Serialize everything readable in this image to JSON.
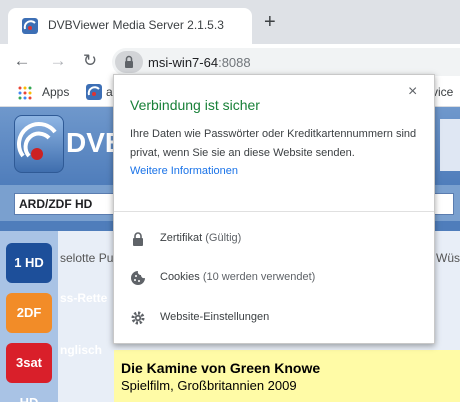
{
  "tab": {
    "title": "DVBViewer Media Server 2.1.5.3",
    "close_icon": "×"
  },
  "toolbar": {
    "new_tab": "+",
    "url_host": "msi-win7-64",
    "url_port": ":8088"
  },
  "bookmarks": {
    "apps_label": "Apps",
    "bookmark_fragment": "a",
    "right_fragment": "vice"
  },
  "page": {
    "logo_text": "DVB",
    "channel_select": "ARD/ZDF HD",
    "channels": [
      "1 HD",
      "2DF HD",
      "3sat HD"
    ],
    "row1_text": "selotte Pu",
    "row1_right": "Wüs",
    "row2_text": "ss-Rette",
    "row3_text": "nglisch",
    "program_title": "Die Kamine von Green Knowe",
    "program_subtitle": "Spielfilm, Großbritannien 2009"
  },
  "popup": {
    "title": "Verbindung ist sicher",
    "close": "×",
    "description": "Ihre Daten wie Passwörter oder Kreditkartennummern sind privat, wenn Sie sie an diese Website senden.",
    "more_link": "Weitere Informationen",
    "certificate_label": "Zertifikat",
    "certificate_status": "(Gültig)",
    "cookies_label": "Cookies",
    "cookies_status": "(10 werden verwendet)",
    "site_settings_label": "Website-Einstellungen"
  },
  "colors": {
    "secure_green": "#188038",
    "link_blue": "#1a73e8",
    "highlight_yellow": "#fffba6"
  }
}
